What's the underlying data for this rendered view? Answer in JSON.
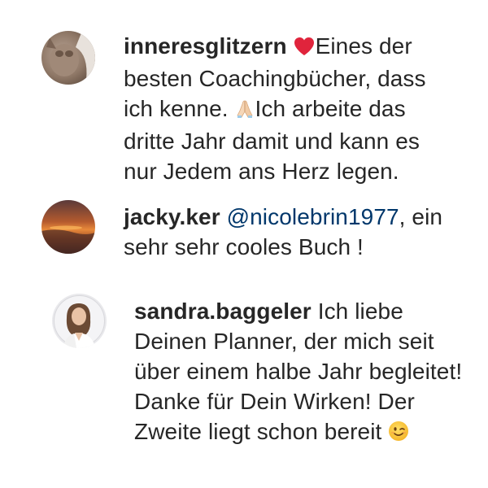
{
  "comments": [
    {
      "username": "inneresglitzern",
      "avatar_icon": "cat-photo-avatar",
      "lines": [
        {
          "emoji_before": "red-heart",
          "text": "Eines der"
        },
        {
          "text": "besten Coachingbücher, dass"
        },
        {
          "text": "ich kenne. ",
          "emoji_after": "folded-hands",
          "text_after": "Ich arbeite das"
        },
        {
          "text": "dritte Jahr damit und kann es"
        },
        {
          "text": "nur Jedem ans Herz legen."
        }
      ]
    },
    {
      "username": "jacky.ker",
      "avatar_icon": "sunset-photo-avatar",
      "mention": "@nicolebrin1977",
      "line1_rest": ", ein",
      "line2": "sehr sehr cooles Buch !"
    },
    {
      "username": "sandra.baggeler",
      "avatar_icon": "woman-portrait-avatar",
      "line1_rest": " Ich liebe",
      "lines": [
        "Deinen Planner, der mich seit",
        "über einem halbe Jahr begleitet!",
        "Danke für Dein Wirken! Der",
        "Zweite liegt schon bereit "
      ],
      "final_emoji": "winking-face"
    }
  ],
  "colors": {
    "text": "#262626",
    "mention": "#00376b",
    "background": "#ffffff"
  }
}
